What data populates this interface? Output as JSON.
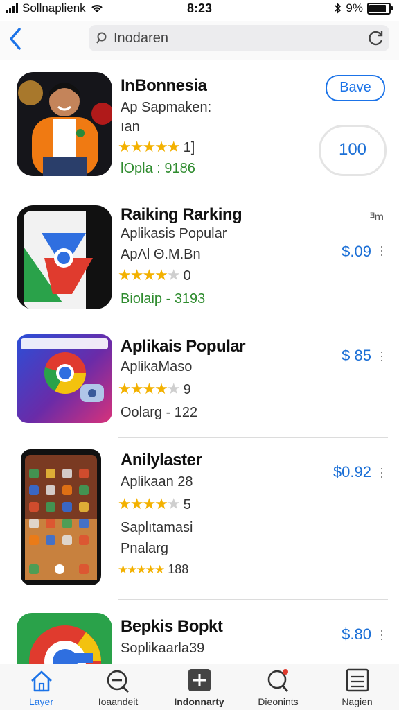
{
  "status_bar": {
    "carrier": "Sollnaplienk",
    "time": "8:23",
    "battery": "9%",
    "icons": [
      "signal-icon",
      "wifi-icon",
      "bluetooth-icon",
      "battery-icon"
    ]
  },
  "header": {
    "search_text": "Inodaren",
    "icons": [
      "back-chevron-icon",
      "search-icon",
      "reload-icon"
    ]
  },
  "apps": [
    {
      "title": "InBonnesia",
      "lines": [
        "Ap Sapmaken:",
        "ıan"
      ],
      "rating_stars": 5,
      "rating_text": "1]",
      "meta": "lOpla : 9186",
      "save_label": "Bave",
      "action_label": "100"
    },
    {
      "title": "Raiking Rarking",
      "corner_text": "ᴲm",
      "lines": [
        "Aplikasis Popular",
        "ApΛl Θ.M.Bn"
      ],
      "rating_stars": 3.5,
      "rating_text": "0",
      "meta": "Biolaip - 3193",
      "price": "$.09"
    },
    {
      "title": "Aplikais Popular",
      "lines": [
        "AplikaMaso"
      ],
      "rating_stars": 3.5,
      "rating_text": "9",
      "meta": "Oolarg - 122",
      "price": "$ 85"
    },
    {
      "title": "Anilylaster",
      "lines": [
        "Aplikaan 28",
        "Saplıtamasi",
        "Pnalarg"
      ],
      "rating_stars": 3.5,
      "rating_text": "5",
      "meta": "188",
      "price": "$0.92"
    },
    {
      "title": "Bepkis Bopkt",
      "lines": [
        "Soplikaarla39"
      ],
      "price": "$.80"
    }
  ],
  "tabs": [
    {
      "label": "Layer",
      "icon": "home-icon",
      "active": true
    },
    {
      "label": "Ioaandeit",
      "icon": "search-minus-icon",
      "active": false
    },
    {
      "label": "Indonnarty",
      "icon": "plus-square-icon",
      "active": false
    },
    {
      "label": "Dieonints",
      "icon": "magnifier-badge-icon",
      "active": false
    },
    {
      "label": "Nagien",
      "icon": "list-icon",
      "active": false
    }
  ],
  "colors": {
    "accent": "#1b73e8",
    "star": "#f3b100",
    "green": "#2e8b2e"
  }
}
